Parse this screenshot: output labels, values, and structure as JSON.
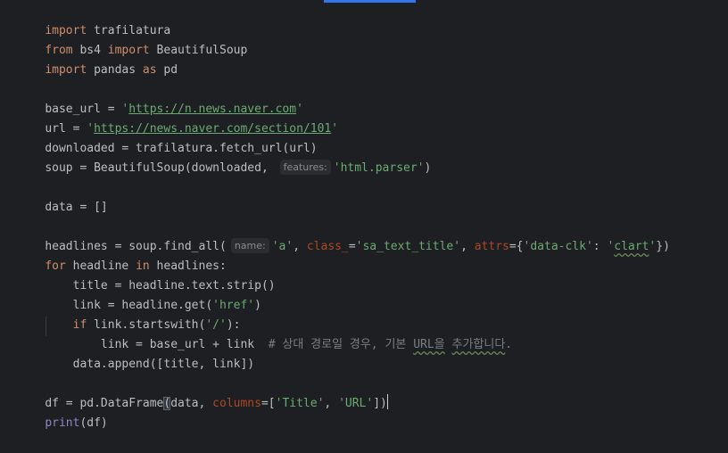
{
  "colors": {
    "background": "#1e1f22",
    "text": "#bcbec4",
    "keyword": "#cf8e6d",
    "string": "#6aab73",
    "parameter": "#aa4926",
    "comment": "#7a7e85",
    "hint_bg": "#2b2d30",
    "accent": "#3574f0"
  },
  "code": {
    "l1": {
      "kw": "import",
      "rest": " trafilatura"
    },
    "l2": {
      "kw1": "from",
      "mid": " bs4 ",
      "kw2": "import",
      "rest": " BeautifulSoup"
    },
    "l3": {
      "kw1": "import",
      "mid": " pandas ",
      "kw2": "as",
      "rest": " pd"
    },
    "l5": {
      "pre": "base_url = ",
      "q1": "'",
      "url": "https://n.news.naver.com",
      "q2": "'"
    },
    "l6": {
      "pre": "url = ",
      "q1": "'",
      "url": "https://news.naver.com/section/101",
      "q2": "'"
    },
    "l7": {
      "text": "downloaded = trafilatura.fetch_url(url)"
    },
    "l8": {
      "pre": "soup = BeautifulSoup(downloaded, ",
      "hint": "features:",
      "str": "'html.parser'",
      "post": ")"
    },
    "l10": {
      "text": "data = []"
    },
    "l12": {
      "pre": "headlines = soup.find_all(",
      "hint": "name:",
      "s1": "'a'",
      "c1": ", ",
      "p1": "class_",
      "eq1": "=",
      "s2": "'sa_text_title'",
      "c2": ", ",
      "p2": "attrs",
      "eq2": "={",
      "s3": "'data-clk'",
      "colon": ": ",
      "s4q": "'",
      "s4": "clart",
      "s4q2": "'",
      "post": "})"
    },
    "l13": {
      "kw1": "for",
      "mid": " headline ",
      "kw2": "in",
      "rest": " headlines:"
    },
    "l14": {
      "text": "    title = headline.text.strip()"
    },
    "l15": {
      "pre": "    link = headline.get(",
      "str": "'href'",
      "post": ")"
    },
    "l16": {
      "indent": "    ",
      "kw": "if",
      "pre": " link.startswith(",
      "str": "'/'",
      "post": "):"
    },
    "l17": {
      "pre": "        link = base_url + link  ",
      "c1": "# 상대 경로일 경우, 기본 ",
      "c2": "URL을",
      "c3": " ",
      "c4": "추가합니다",
      "c5": "."
    },
    "l18": {
      "text": "    data.append([title, link])"
    },
    "l20": {
      "pre": "df = pd.DataFrame",
      "paren": "(",
      "mid": "data, ",
      "param": "columns",
      "eq": "=[",
      "s1": "'Title'",
      "c": ", ",
      "s2": "'URL'",
      "post": "])"
    },
    "l21": {
      "fn": "print",
      "rest": "(df)"
    }
  }
}
